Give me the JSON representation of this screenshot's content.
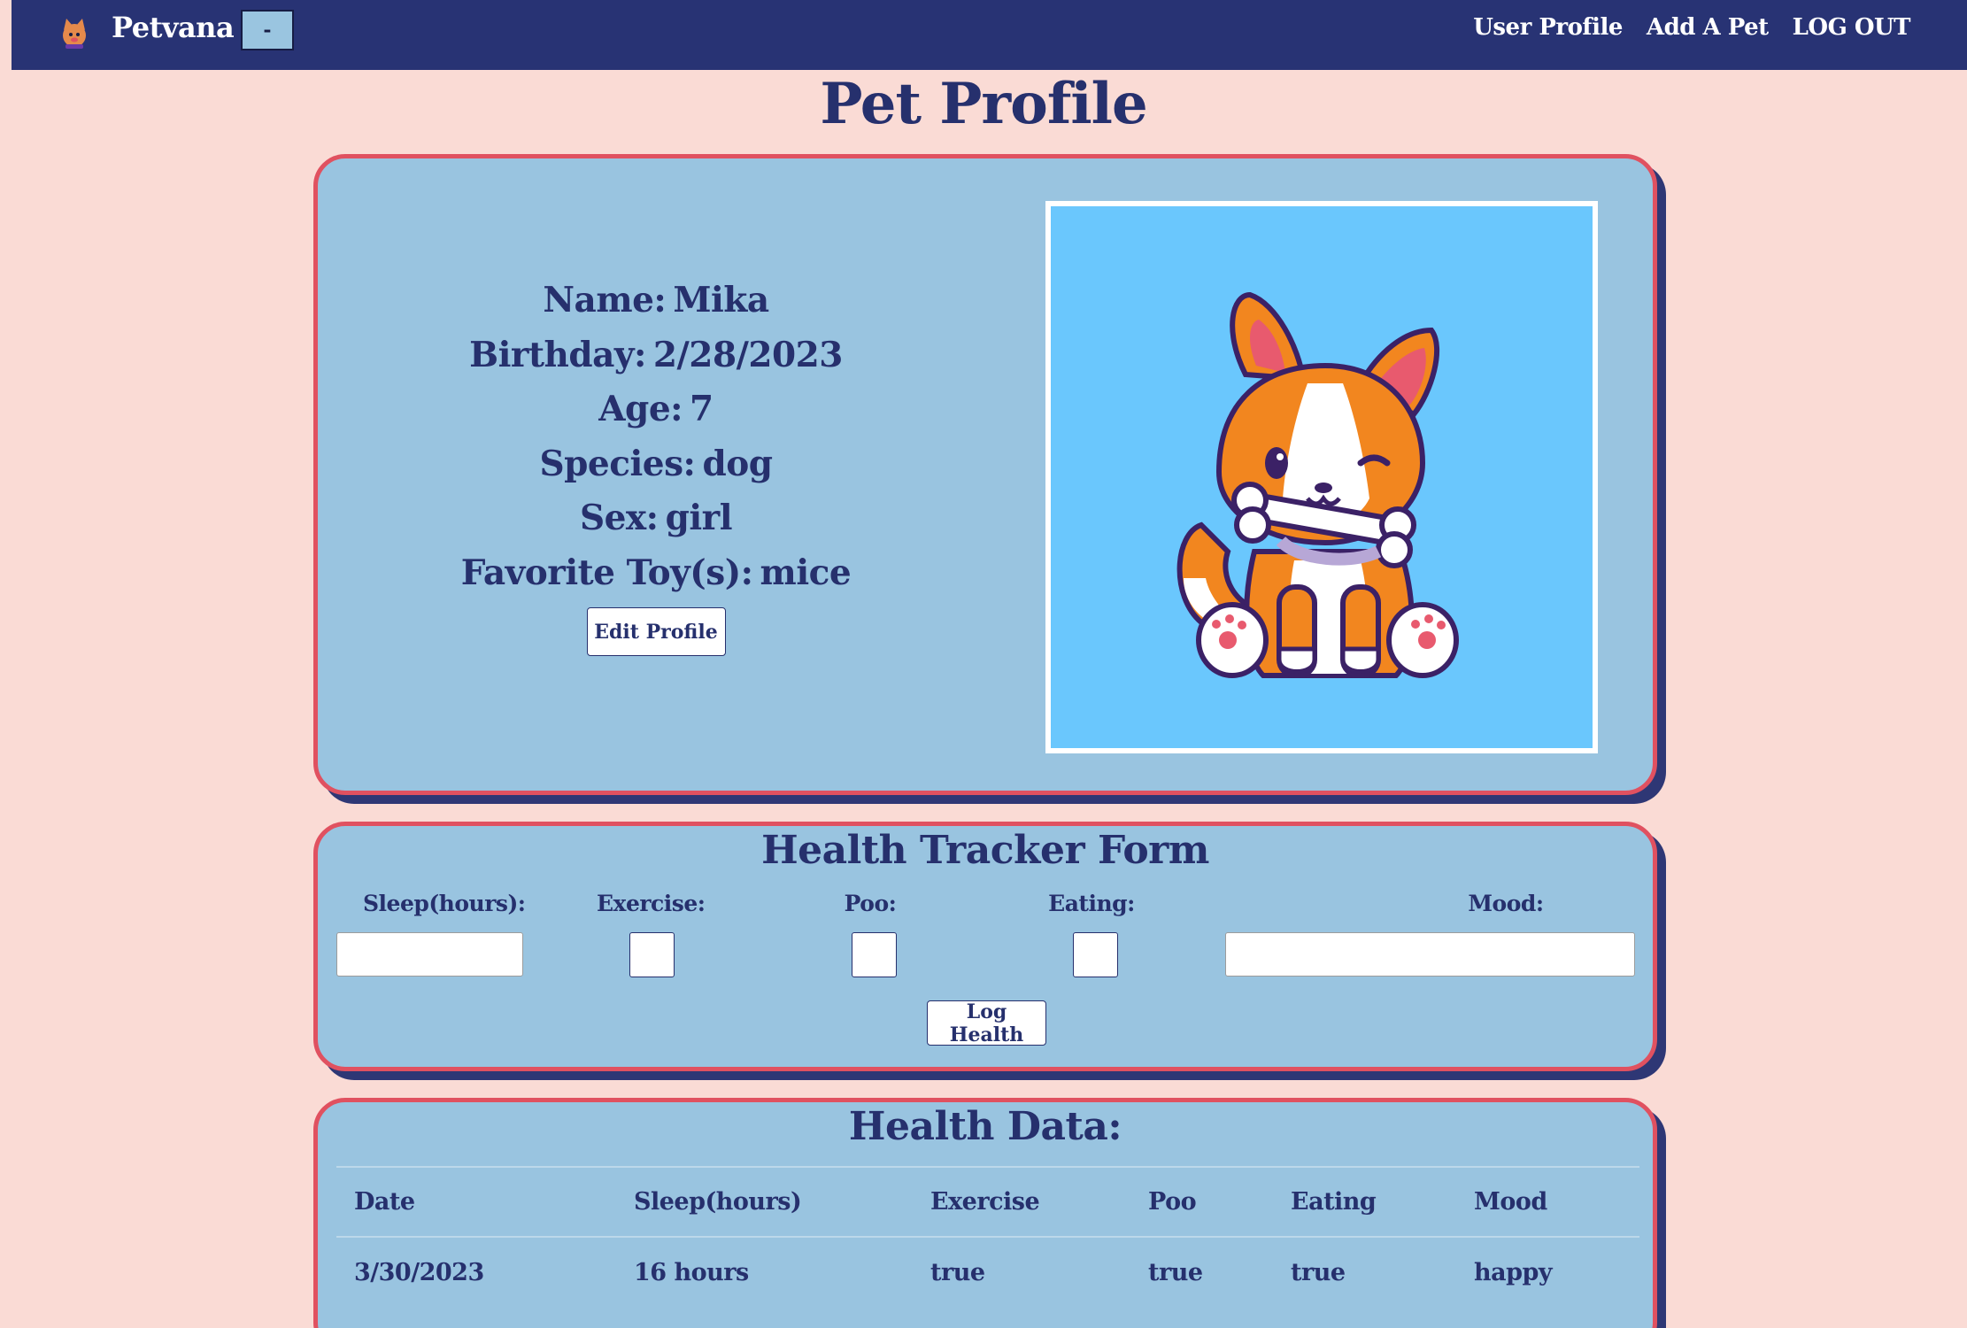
{
  "nav": {
    "brand": "Petvana",
    "toggle_label": "-",
    "links": [
      "User Profile",
      "Add A Pet",
      "LOG OUT"
    ]
  },
  "page_title": "Pet Profile",
  "profile": {
    "name_label": "Name:",
    "name": "Mika",
    "birthday_label": "Birthday:",
    "birthday": "2/28/2023",
    "age_label": "Age:",
    "age": "7",
    "species_label": "Species:",
    "species": "dog",
    "sex_label": "Sex:",
    "sex": "girl",
    "toys_label": "Favorite Toy(s):",
    "toys": "mice",
    "edit_button": "Edit Profile",
    "photo_icon": "corgi-with-bone-illustration"
  },
  "health_form": {
    "title": "Health Tracker Form",
    "labels": {
      "sleep": "Sleep(hours):",
      "exercise": "Exercise:",
      "poo": "Poo:",
      "eating": "Eating:",
      "mood": "Mood:"
    },
    "sleep_value": "",
    "mood_value": "",
    "submit_button": "Log Health"
  },
  "health_data": {
    "title": "Health Data:",
    "columns": [
      "Date",
      "Sleep(hours)",
      "Exercise",
      "Poo",
      "Eating",
      "Mood"
    ],
    "rows": [
      [
        "3/30/2023",
        "16 hours",
        "true",
        "true",
        "true",
        "happy"
      ]
    ]
  },
  "colors": {
    "page_bg": "#fadbd5",
    "navbar": "#283374",
    "card_bg": "#99c4e0",
    "card_border": "#e05160",
    "text": "#26306d",
    "photo_bg": "#6ac7fd"
  }
}
